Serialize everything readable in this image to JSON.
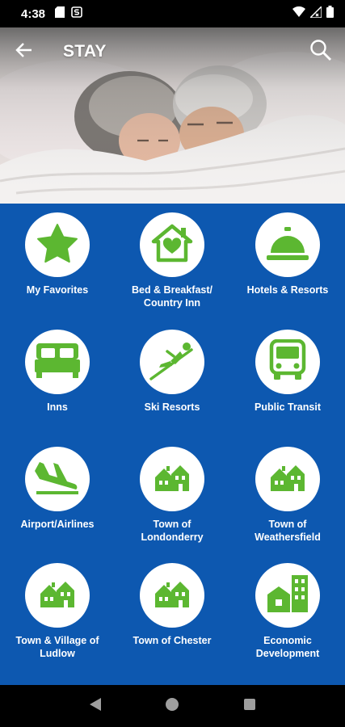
{
  "status_bar": {
    "time": "4:38",
    "icons": [
      "sd-card-icon",
      "s-notification-icon",
      "wifi-icon",
      "signal-icon",
      "battery-icon"
    ]
  },
  "header": {
    "title": "STAY",
    "back_icon": "arrow-left-icon",
    "search_icon": "search-icon"
  },
  "colors": {
    "background_blue": "#0d58b0",
    "icon_green": "#5cb731",
    "circle_white": "#ffffff"
  },
  "tiles": [
    {
      "label": "My Favorites",
      "icon": "star-icon"
    },
    {
      "label": "Bed & Breakfast/\nCountry Inn",
      "icon": "house-heart-icon"
    },
    {
      "label": "Hotels & Resorts",
      "icon": "service-bell-icon"
    },
    {
      "label": "Inns",
      "icon": "bed-icon"
    },
    {
      "label": "Ski Resorts",
      "icon": "ski-jumper-icon"
    },
    {
      "label": "Public Transit",
      "icon": "bus-icon"
    },
    {
      "label": "Airport/Airlines",
      "icon": "airplane-landing-icon"
    },
    {
      "label": "Town of\nLondonderry",
      "icon": "town-houses-icon"
    },
    {
      "label": "Town of\nWeathersfield",
      "icon": "town-houses-icon"
    },
    {
      "label": "Town & Village of\nLudlow",
      "icon": "town-houses-icon"
    },
    {
      "label": "Town of Chester",
      "icon": "town-houses-icon"
    },
    {
      "label": "Economic\nDevelopment",
      "icon": "city-buildings-icon"
    }
  ],
  "nav": {
    "back": "nav-back-icon",
    "home": "nav-home-icon",
    "recents": "nav-recents-icon"
  }
}
